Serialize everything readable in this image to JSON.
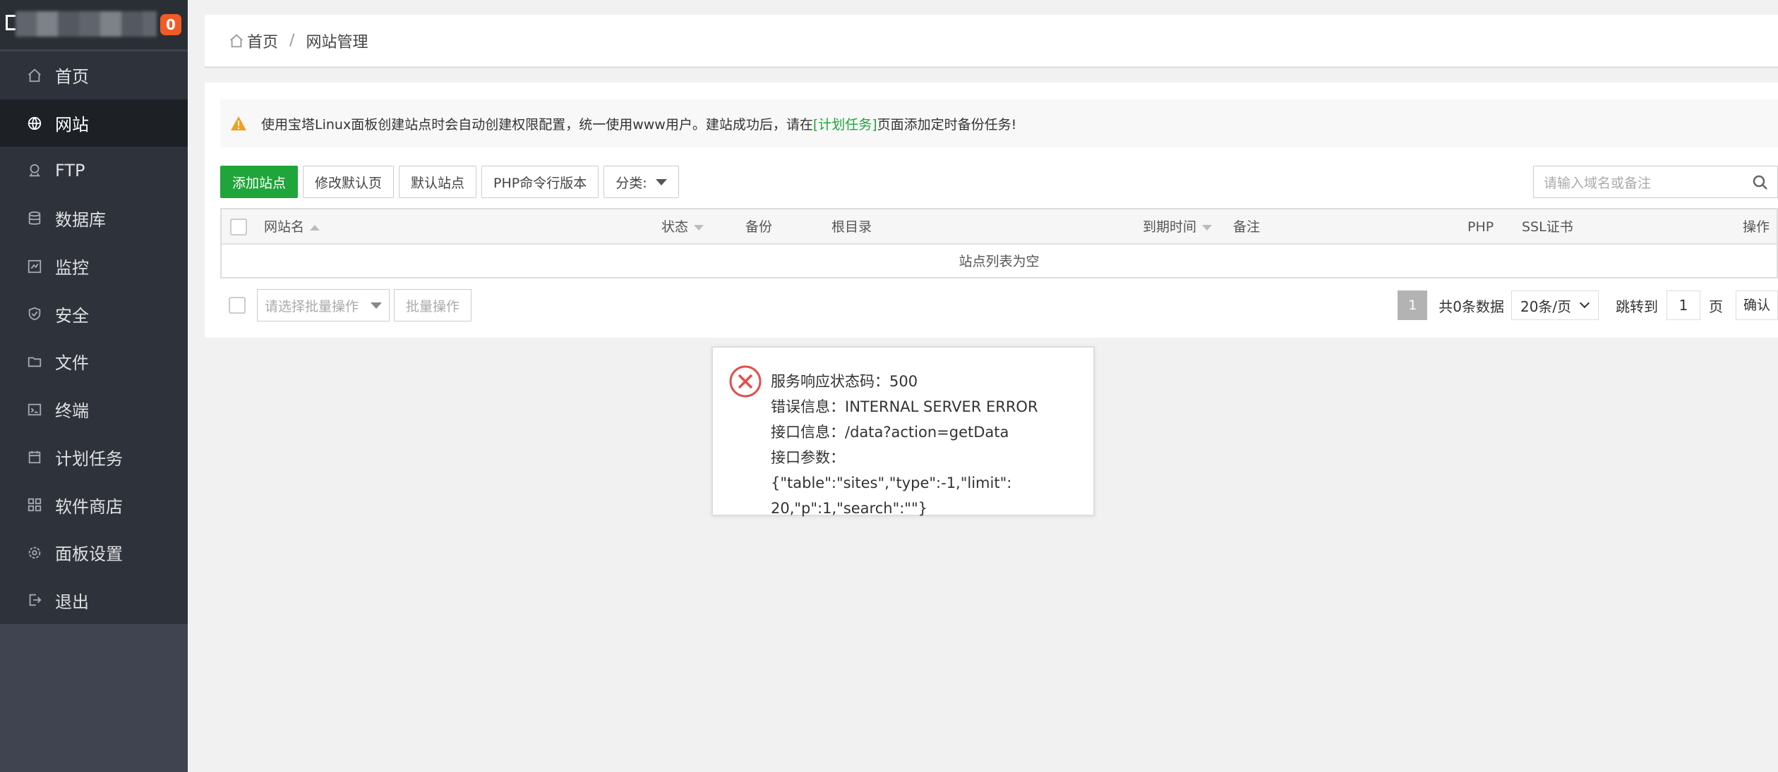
{
  "sidebar": {
    "badge_count": "0",
    "items": [
      {
        "label": "首页",
        "icon": "home-icon"
      },
      {
        "label": "网站",
        "icon": "globe-icon",
        "active": true
      },
      {
        "label": "FTP",
        "icon": "ftp-icon"
      },
      {
        "label": "数据库",
        "icon": "database-icon"
      },
      {
        "label": "监控",
        "icon": "monitor-icon"
      },
      {
        "label": "安全",
        "icon": "shield-icon"
      },
      {
        "label": "文件",
        "icon": "folder-icon"
      },
      {
        "label": "终端",
        "icon": "terminal-icon"
      },
      {
        "label": "计划任务",
        "icon": "calendar-icon"
      },
      {
        "label": "软件商店",
        "icon": "grid-icon"
      },
      {
        "label": "面板设置",
        "icon": "gear-icon"
      },
      {
        "label": "退出",
        "icon": "logout-icon"
      }
    ]
  },
  "breadcrumb": {
    "home": "首页",
    "separator": "/",
    "current": "网站管理"
  },
  "notice": {
    "text_before": "使用宝塔Linux面板创建站点时会自动创建权限配置，统一使用www用户。建站成功后，请在",
    "link": "[计划任务]",
    "text_after": "页面添加定时备份任务!"
  },
  "toolbar": {
    "add_site": "添加站点",
    "edit_default_page": "修改默认页",
    "default_site": "默认站点",
    "php_cli_version": "PHP命令行版本",
    "category": "分类:"
  },
  "search": {
    "placeholder": "请输入域名或备注"
  },
  "table": {
    "headers": {
      "name": "网站名",
      "status": "状态",
      "backup": "备份",
      "root": "根目录",
      "expire": "到期时间",
      "remark": "备注",
      "php": "PHP",
      "ssl": "SSL证书",
      "action": "操作"
    },
    "empty_text": "站点列表为空"
  },
  "bulk": {
    "placeholder": "请选择批量操作",
    "button": "批量操作"
  },
  "pager": {
    "current": "1",
    "total": "共0条数据",
    "page_size": "20条/页",
    "jump_label": "跳转到",
    "jump_value": "1",
    "unit": "页",
    "confirm": "确认"
  },
  "error_dialog": {
    "line1": "服务响应状态码：500",
    "line2": "错误信息：INTERNAL SERVER ERROR",
    "line3": "接口信息：/data?action=getData",
    "line4": "接口参数：{\"table\":\"sites\",\"type\":-1,\"limit\":",
    "line5": "20,\"p\":1,\"search\":\"\"}"
  },
  "colors": {
    "accent": "#20a53a",
    "badge": "#f15b26",
    "sidebar": "#3f4450",
    "error": "#e0504d"
  }
}
